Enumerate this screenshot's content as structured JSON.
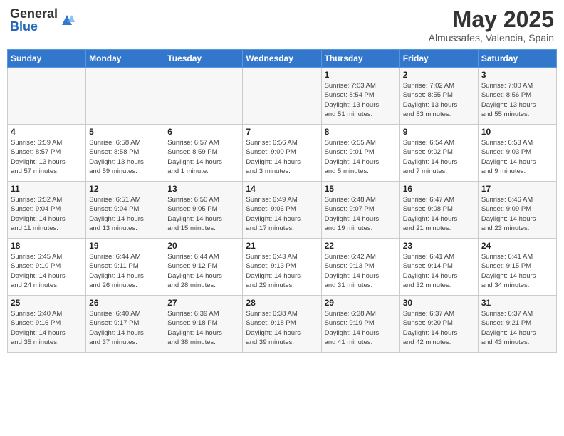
{
  "header": {
    "logo_general": "General",
    "logo_blue": "Blue",
    "month": "May 2025",
    "location": "Almussafes, Valencia, Spain"
  },
  "days_of_week": [
    "Sunday",
    "Monday",
    "Tuesday",
    "Wednesday",
    "Thursday",
    "Friday",
    "Saturday"
  ],
  "weeks": [
    [
      {
        "day": "",
        "info": ""
      },
      {
        "day": "",
        "info": ""
      },
      {
        "day": "",
        "info": ""
      },
      {
        "day": "",
        "info": ""
      },
      {
        "day": "1",
        "info": "Sunrise: 7:03 AM\nSunset: 8:54 PM\nDaylight: 13 hours\nand 51 minutes."
      },
      {
        "day": "2",
        "info": "Sunrise: 7:02 AM\nSunset: 8:55 PM\nDaylight: 13 hours\nand 53 minutes."
      },
      {
        "day": "3",
        "info": "Sunrise: 7:00 AM\nSunset: 8:56 PM\nDaylight: 13 hours\nand 55 minutes."
      }
    ],
    [
      {
        "day": "4",
        "info": "Sunrise: 6:59 AM\nSunset: 8:57 PM\nDaylight: 13 hours\nand 57 minutes."
      },
      {
        "day": "5",
        "info": "Sunrise: 6:58 AM\nSunset: 8:58 PM\nDaylight: 13 hours\nand 59 minutes."
      },
      {
        "day": "6",
        "info": "Sunrise: 6:57 AM\nSunset: 8:59 PM\nDaylight: 14 hours\nand 1 minute."
      },
      {
        "day": "7",
        "info": "Sunrise: 6:56 AM\nSunset: 9:00 PM\nDaylight: 14 hours\nand 3 minutes."
      },
      {
        "day": "8",
        "info": "Sunrise: 6:55 AM\nSunset: 9:01 PM\nDaylight: 14 hours\nand 5 minutes."
      },
      {
        "day": "9",
        "info": "Sunrise: 6:54 AM\nSunset: 9:02 PM\nDaylight: 14 hours\nand 7 minutes."
      },
      {
        "day": "10",
        "info": "Sunrise: 6:53 AM\nSunset: 9:03 PM\nDaylight: 14 hours\nand 9 minutes."
      }
    ],
    [
      {
        "day": "11",
        "info": "Sunrise: 6:52 AM\nSunset: 9:04 PM\nDaylight: 14 hours\nand 11 minutes."
      },
      {
        "day": "12",
        "info": "Sunrise: 6:51 AM\nSunset: 9:04 PM\nDaylight: 14 hours\nand 13 minutes."
      },
      {
        "day": "13",
        "info": "Sunrise: 6:50 AM\nSunset: 9:05 PM\nDaylight: 14 hours\nand 15 minutes."
      },
      {
        "day": "14",
        "info": "Sunrise: 6:49 AM\nSunset: 9:06 PM\nDaylight: 14 hours\nand 17 minutes."
      },
      {
        "day": "15",
        "info": "Sunrise: 6:48 AM\nSunset: 9:07 PM\nDaylight: 14 hours\nand 19 minutes."
      },
      {
        "day": "16",
        "info": "Sunrise: 6:47 AM\nSunset: 9:08 PM\nDaylight: 14 hours\nand 21 minutes."
      },
      {
        "day": "17",
        "info": "Sunrise: 6:46 AM\nSunset: 9:09 PM\nDaylight: 14 hours\nand 23 minutes."
      }
    ],
    [
      {
        "day": "18",
        "info": "Sunrise: 6:45 AM\nSunset: 9:10 PM\nDaylight: 14 hours\nand 24 minutes."
      },
      {
        "day": "19",
        "info": "Sunrise: 6:44 AM\nSunset: 9:11 PM\nDaylight: 14 hours\nand 26 minutes."
      },
      {
        "day": "20",
        "info": "Sunrise: 6:44 AM\nSunset: 9:12 PM\nDaylight: 14 hours\nand 28 minutes."
      },
      {
        "day": "21",
        "info": "Sunrise: 6:43 AM\nSunset: 9:13 PM\nDaylight: 14 hours\nand 29 minutes."
      },
      {
        "day": "22",
        "info": "Sunrise: 6:42 AM\nSunset: 9:13 PM\nDaylight: 14 hours\nand 31 minutes."
      },
      {
        "day": "23",
        "info": "Sunrise: 6:41 AM\nSunset: 9:14 PM\nDaylight: 14 hours\nand 32 minutes."
      },
      {
        "day": "24",
        "info": "Sunrise: 6:41 AM\nSunset: 9:15 PM\nDaylight: 14 hours\nand 34 minutes."
      }
    ],
    [
      {
        "day": "25",
        "info": "Sunrise: 6:40 AM\nSunset: 9:16 PM\nDaylight: 14 hours\nand 35 minutes."
      },
      {
        "day": "26",
        "info": "Sunrise: 6:40 AM\nSunset: 9:17 PM\nDaylight: 14 hours\nand 37 minutes."
      },
      {
        "day": "27",
        "info": "Sunrise: 6:39 AM\nSunset: 9:18 PM\nDaylight: 14 hours\nand 38 minutes."
      },
      {
        "day": "28",
        "info": "Sunrise: 6:38 AM\nSunset: 9:18 PM\nDaylight: 14 hours\nand 39 minutes."
      },
      {
        "day": "29",
        "info": "Sunrise: 6:38 AM\nSunset: 9:19 PM\nDaylight: 14 hours\nand 41 minutes."
      },
      {
        "day": "30",
        "info": "Sunrise: 6:37 AM\nSunset: 9:20 PM\nDaylight: 14 hours\nand 42 minutes."
      },
      {
        "day": "31",
        "info": "Sunrise: 6:37 AM\nSunset: 9:21 PM\nDaylight: 14 hours\nand 43 minutes."
      }
    ]
  ]
}
